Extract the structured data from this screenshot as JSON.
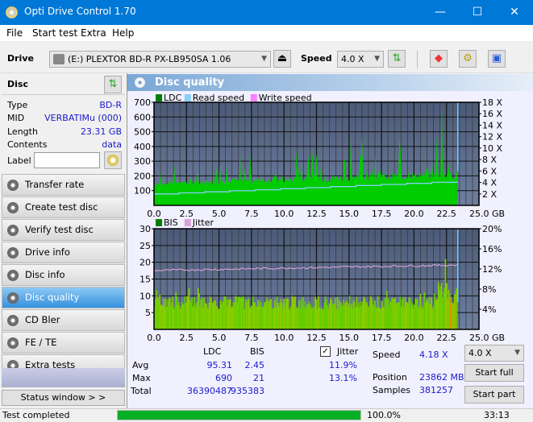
{
  "window": {
    "title": "Opti Drive Control 1.70",
    "minimize": "—",
    "maximize": "☐",
    "close": "✕"
  },
  "menu": [
    "File",
    "Start test",
    "Extra",
    "Help"
  ],
  "toolbar": {
    "drive_label": "Drive",
    "drive_value": "(E:)  PLEXTOR BD-R  PX-LB950SA 1.06",
    "speed_label": "Speed",
    "speed_value": "4.0 X",
    "eject": "⏏"
  },
  "disc": {
    "heading": "Disc",
    "rows": [
      {
        "label": "Type",
        "value": "BD-R"
      },
      {
        "label": "MID",
        "value": "VERBATIMu (000)"
      },
      {
        "label": "Length",
        "value": "23.31 GB"
      },
      {
        "label": "Contents",
        "value": "data"
      }
    ],
    "label_field": "Label",
    "label_value": ""
  },
  "nav": [
    {
      "label": "Transfer rate",
      "active": false
    },
    {
      "label": "Create test disc",
      "active": false
    },
    {
      "label": "Verify test disc",
      "active": false
    },
    {
      "label": "Drive info",
      "active": false
    },
    {
      "label": "Disc info",
      "active": false
    },
    {
      "label": "Disc quality",
      "active": true
    },
    {
      "label": "CD Bler",
      "active": false
    },
    {
      "label": "FE / TE",
      "active": false
    },
    {
      "label": "Extra tests",
      "active": false
    }
  ],
  "status_window_btn": "Status window > >",
  "main": {
    "title": "Disc quality"
  },
  "chart_data": [
    {
      "type": "area",
      "title": "LDC chart",
      "legend": [
        "LDC",
        "Read speed",
        "Write speed"
      ],
      "legend_colors": [
        "#008000",
        "#87cefa",
        "#ff80ff"
      ],
      "x_ticks": [
        "0.0",
        "2.5",
        "5.0",
        "7.5",
        "10.0",
        "12.5",
        "15.0",
        "17.5",
        "20.0",
        "22.5",
        "25.0 GB"
      ],
      "xlim": [
        0,
        25
      ],
      "y_ticks": [
        "100",
        "200",
        "300",
        "400",
        "500",
        "600",
        "700"
      ],
      "ylim": [
        0,
        700
      ],
      "y2_ticks": [
        "2 X",
        "4 X",
        "6 X",
        "8 X",
        "10 X",
        "12 X",
        "14 X",
        "16 X",
        "18 X"
      ],
      "y2lim": [
        0,
        18
      ],
      "ldc_baseline_start": 150,
      "ldc_baseline_end": 210,
      "ldc_max": 690,
      "end_gb": 23.31,
      "read_speed_start": 2.0,
      "read_speed_end": 4.2
    },
    {
      "type": "bar",
      "title": "BIS chart",
      "legend": [
        "BIS",
        "Jitter"
      ],
      "legend_colors": [
        "#008000",
        "#d8a0d8"
      ],
      "x_ticks": [
        "0.0",
        "2.5",
        "5.0",
        "7.5",
        "10.0",
        "12.5",
        "15.0",
        "17.5",
        "20.0",
        "22.5",
        "25.0 GB"
      ],
      "xlim": [
        0,
        25
      ],
      "y_ticks": [
        "5",
        "10",
        "15",
        "20",
        "25",
        "30"
      ],
      "ylim": [
        0,
        30
      ],
      "y2_ticks": [
        "4%",
        "8%",
        "12%",
        "16%",
        "20%"
      ],
      "y2lim": [
        0,
        20
      ],
      "jitter_start": 11.7,
      "jitter_end": 12.8,
      "bis_max": 21,
      "end_gb": 23.31
    }
  ],
  "stats": {
    "col_ldc": "LDC",
    "col_bis": "BIS",
    "jitter_label": "Jitter",
    "jitter_checked": true,
    "rows": [
      {
        "label": "Avg",
        "ldc": "95.31",
        "bis": "2.45",
        "jitter": "11.9%"
      },
      {
        "label": "Max",
        "ldc": "690",
        "bis": "21",
        "jitter": "13.1%"
      },
      {
        "label": "Total",
        "ldc": "36390487",
        "bis": "935383",
        "jitter": ""
      }
    ],
    "speed_label": "Speed",
    "speed_value": "4.18 X",
    "position_label": "Position",
    "position_value": "23862 MB",
    "samples_label": "Samples",
    "samples_value": "381257",
    "speed_select": "4.0 X",
    "start_full": "Start full",
    "start_part": "Start part"
  },
  "statusbar": {
    "text": "Test completed",
    "progress": 100.0,
    "progress_text": "100.0%",
    "time": "33:13"
  }
}
